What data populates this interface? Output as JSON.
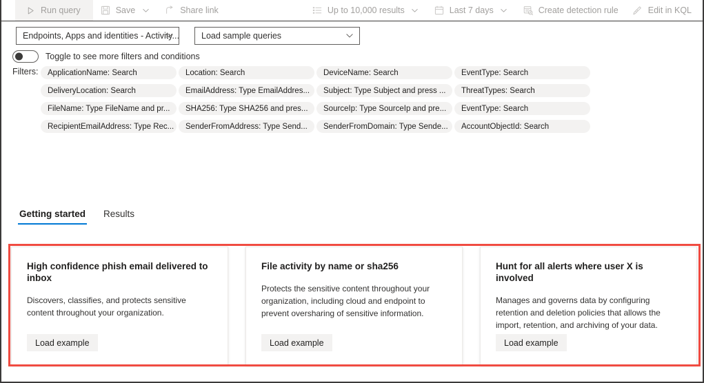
{
  "commandbar": {
    "left_items": [
      {
        "id": "run-query",
        "label": "Run query",
        "icon": "play-icon",
        "primary": true,
        "caret": false
      },
      {
        "id": "save",
        "label": "Save",
        "icon": "save-icon",
        "primary": false,
        "caret": true
      },
      {
        "id": "share-link",
        "label": "Share link",
        "icon": "share-icon",
        "primary": false,
        "caret": false
      }
    ],
    "right_items": [
      {
        "id": "results-limit",
        "label": "Up to 10,000 results",
        "icon": "list-icon",
        "caret": true
      },
      {
        "id": "time-range",
        "label": "Last 7 days",
        "icon": "calendar-icon",
        "caret": true
      },
      {
        "id": "create-detection-rule",
        "label": "Create detection rule",
        "icon": "detection-rule-icon",
        "caret": false
      },
      {
        "id": "edit-in-kql",
        "label": "Edit in KQL",
        "icon": "kql-edit-icon",
        "caret": false
      }
    ]
  },
  "selectors": {
    "scope": {
      "value": "Endpoints, Apps and identities - Activity...",
      "icon": "chevron-down-icon"
    },
    "samples": {
      "value": "Load sample queries",
      "icon": "chevron-down-icon"
    }
  },
  "toggle": {
    "state": "off",
    "label": "Toggle to see more filters and conditions"
  },
  "filters": {
    "label": "Filters:",
    "pills": [
      "ApplicationName: Search",
      "Location: Search",
      "DeviceName: Search",
      "EventType: Search",
      "DeliveryLocation: Search",
      "EmailAddress: Type EmailAddres...",
      "Subject: Type Subject and press ...",
      "ThreatTypes: Search",
      "FileName: Type FileName and pr...",
      "SHA256: Type SHA256 and pres...",
      "SourceIp: Type SourceIp and pre...",
      "EventType: Search",
      "RecipientEmailAddress: Type Rec...",
      "SenderFromAddress: Type Send...",
      "SenderFromDomain: Type Sende...",
      "AccountObjectId: Search"
    ]
  },
  "tabs": [
    {
      "id": "getting-started",
      "label": "Getting started",
      "active": true
    },
    {
      "id": "results",
      "label": "Results",
      "active": false
    }
  ],
  "cards": [
    {
      "id": "high-confidence-phish",
      "title": "High confidence phish email delivered to inbox",
      "description": "Discovers, classifies, and protects sensitive content throughout your organization.",
      "button": "Load example"
    },
    {
      "id": "file-activity",
      "title": "File activity by name or sha256",
      "description": "Protects the sensitive content throughout your organization, including cloud and endpoint to prevent oversharing of sensitive information.",
      "button": "Load example"
    },
    {
      "id": "hunt-alerts-user",
      "title": "Hunt for all alerts where user X is involved",
      "description": "Manages and governs data by configuring retention and deletion policies that allows the import, retention, and archiving of your data.",
      "button": "Load example"
    }
  ],
  "colors": {
    "accent": "#0078d4",
    "highlight": "#f04b41",
    "disabled_text": "#a19f9d",
    "pill_bg": "#f3f2f1"
  }
}
